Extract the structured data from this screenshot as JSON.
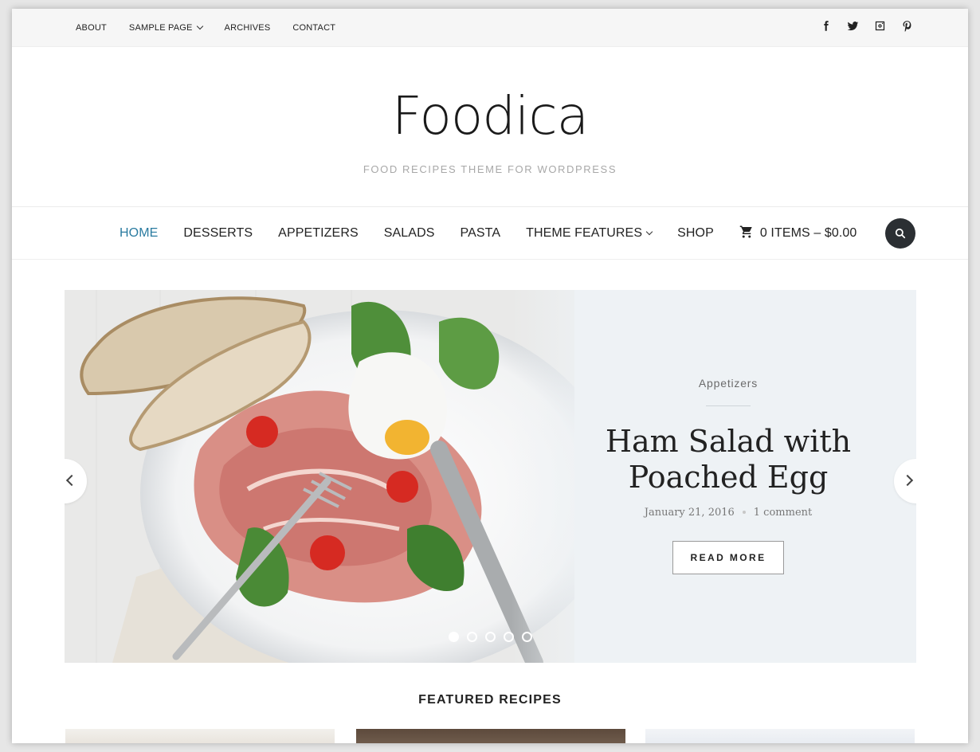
{
  "topbar": {
    "nav": [
      {
        "label": "About"
      },
      {
        "label": "Sample Page",
        "has_dropdown": true
      },
      {
        "label": "Archives"
      },
      {
        "label": "Contact"
      }
    ],
    "social_icons": [
      "facebook-icon",
      "twitter-icon",
      "instagram-icon",
      "pinterest-icon"
    ]
  },
  "branding": {
    "site_title": "Foodica",
    "tagline": "Food Recipes Theme for WordPress"
  },
  "main_nav": {
    "items": [
      {
        "label": "Home",
        "active": true
      },
      {
        "label": "Desserts"
      },
      {
        "label": "Appetizers"
      },
      {
        "label": "Salads"
      },
      {
        "label": "Pasta"
      },
      {
        "label": "Theme Features",
        "has_dropdown": true
      },
      {
        "label": "Shop"
      }
    ],
    "cart_label": "0 items – $0.00",
    "active_color": "#2a7ba0"
  },
  "slider": {
    "category": "Appetizers",
    "title_line1": "Ham Salad with",
    "title_line2": "Poached Egg",
    "date": "January 21, 2016",
    "comments": "1 comment",
    "read_more": "Read More",
    "slide_count": 5,
    "active_slide": 1,
    "background": "#eef2f5"
  },
  "featured": {
    "heading": "Featured Recipes"
  }
}
